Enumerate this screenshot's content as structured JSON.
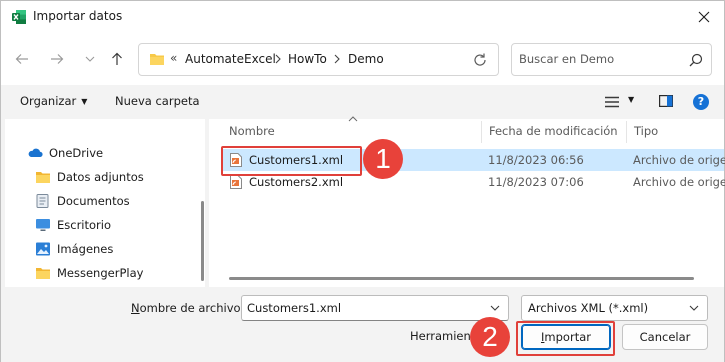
{
  "window": {
    "title": "Importar datos",
    "app_icon": "excel-icon",
    "close_label": "✕"
  },
  "nav": {
    "back_icon": "back-arrow-icon",
    "forward_icon": "forward-arrow-icon",
    "recent_icon": "chevron-down-icon",
    "up_icon": "up-arrow-icon"
  },
  "address": {
    "overflow": "«",
    "crumbs": [
      "AutomateExcel",
      "HowTo",
      "Demo"
    ]
  },
  "search": {
    "placeholder": "Buscar en Demo"
  },
  "toolbar": {
    "organize_label": "Organizar",
    "new_folder_label": "Nueva carpeta"
  },
  "sidebar": {
    "items": [
      {
        "label": "OneDrive",
        "icon": "cloud-icon",
        "color": "#1a73d0"
      },
      {
        "label": "Datos adjuntos",
        "icon": "folder-icon",
        "color": "#f7c948"
      },
      {
        "label": "Documentos",
        "icon": "document-icon",
        "color": "#7b8a9a"
      },
      {
        "label": "Escritorio",
        "icon": "desktop-icon",
        "color": "#3c8ee0"
      },
      {
        "label": "Imágenes",
        "icon": "image-icon",
        "color": "#2b7fd6"
      },
      {
        "label": "MessengerPlay",
        "icon": "folder-icon",
        "color": "#f7c948"
      }
    ]
  },
  "files": {
    "columns": [
      "Nombre",
      "Fecha de modificación",
      "Tipo"
    ],
    "rows": [
      {
        "name": "Customers1.xml",
        "date": "11/8/2023 06:56",
        "type": "Archivo de origen",
        "selected": true
      },
      {
        "name": "Customers2.xml",
        "date": "11/8/2023 07:06",
        "type": "Archivo de origen",
        "selected": false
      }
    ]
  },
  "footer": {
    "filename_label_prefix": "N",
    "filename_label_rest": "ombre de archivo:",
    "filename_value": "Customers1.xml",
    "filter_value": "Archivos XML (*.xml)",
    "tools_label": "Herramientas",
    "import_prefix": "I",
    "import_rest": "mportar",
    "cancel_label": "Cancelar"
  },
  "annotations": {
    "step1": "1",
    "step2": "2"
  },
  "colors": {
    "accent": "#0067c0",
    "selection": "#cce8ff",
    "annotation": "#e0403a"
  }
}
